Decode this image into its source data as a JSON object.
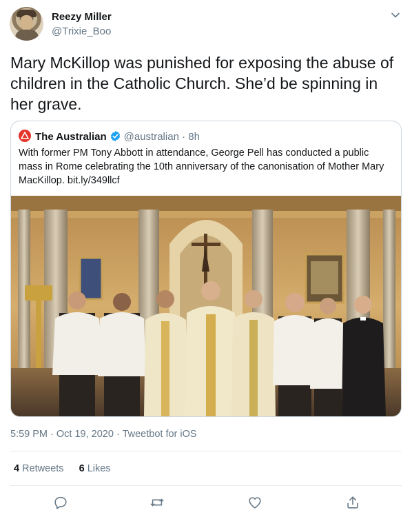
{
  "author": {
    "display_name": "Reezy Miller",
    "handle": "@Trixie_Boo"
  },
  "tweet": {
    "text": "Mary McKillop was punished for exposing the abuse of children in the Catholic Church. She’d be spinning in her grave."
  },
  "quoted": {
    "name": "The Australian",
    "handle": "@australian",
    "separator": "·",
    "time": "8h",
    "text": "With former PM Tony Abbott in attendance, George Pell has conducted a public mass in Rome celebrating the 10th anniversary of the canonisation of Mother Mary MacKillop. bit.ly/349llcf"
  },
  "meta": {
    "time": "5:59 PM",
    "date": "Oct 19, 2020",
    "separator": "·",
    "source": "Tweetbot for iOS"
  },
  "stats": {
    "retweets_count": "4",
    "retweets_label": "Retweets",
    "likes_count": "6",
    "likes_label": "Likes"
  },
  "icons": {
    "caret": "chevron-down-icon",
    "verified": "verified-badge-icon",
    "reply": "reply-icon",
    "retweet": "retweet-icon",
    "like": "heart-icon",
    "share": "share-icon"
  },
  "colors": {
    "text": "#14171a",
    "secondary": "#657786",
    "verified": "#1da1f2",
    "brand_logo": "#e5352b",
    "border": "#ccd6dd"
  }
}
